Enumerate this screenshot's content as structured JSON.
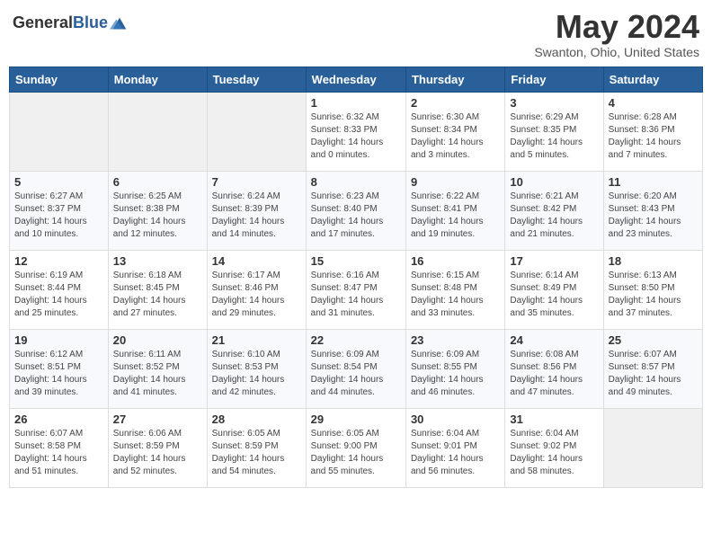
{
  "logo": {
    "general": "General",
    "blue": "Blue"
  },
  "title": "May 2024",
  "location": "Swanton, Ohio, United States",
  "days_of_week": [
    "Sunday",
    "Monday",
    "Tuesday",
    "Wednesday",
    "Thursday",
    "Friday",
    "Saturday"
  ],
  "weeks": [
    [
      {
        "day": "",
        "info": ""
      },
      {
        "day": "",
        "info": ""
      },
      {
        "day": "",
        "info": ""
      },
      {
        "day": "1",
        "info": "Sunrise: 6:32 AM\nSunset: 8:33 PM\nDaylight: 14 hours\nand 0 minutes."
      },
      {
        "day": "2",
        "info": "Sunrise: 6:30 AM\nSunset: 8:34 PM\nDaylight: 14 hours\nand 3 minutes."
      },
      {
        "day": "3",
        "info": "Sunrise: 6:29 AM\nSunset: 8:35 PM\nDaylight: 14 hours\nand 5 minutes."
      },
      {
        "day": "4",
        "info": "Sunrise: 6:28 AM\nSunset: 8:36 PM\nDaylight: 14 hours\nand 7 minutes."
      }
    ],
    [
      {
        "day": "5",
        "info": "Sunrise: 6:27 AM\nSunset: 8:37 PM\nDaylight: 14 hours\nand 10 minutes."
      },
      {
        "day": "6",
        "info": "Sunrise: 6:25 AM\nSunset: 8:38 PM\nDaylight: 14 hours\nand 12 minutes."
      },
      {
        "day": "7",
        "info": "Sunrise: 6:24 AM\nSunset: 8:39 PM\nDaylight: 14 hours\nand 14 minutes."
      },
      {
        "day": "8",
        "info": "Sunrise: 6:23 AM\nSunset: 8:40 PM\nDaylight: 14 hours\nand 17 minutes."
      },
      {
        "day": "9",
        "info": "Sunrise: 6:22 AM\nSunset: 8:41 PM\nDaylight: 14 hours\nand 19 minutes."
      },
      {
        "day": "10",
        "info": "Sunrise: 6:21 AM\nSunset: 8:42 PM\nDaylight: 14 hours\nand 21 minutes."
      },
      {
        "day": "11",
        "info": "Sunrise: 6:20 AM\nSunset: 8:43 PM\nDaylight: 14 hours\nand 23 minutes."
      }
    ],
    [
      {
        "day": "12",
        "info": "Sunrise: 6:19 AM\nSunset: 8:44 PM\nDaylight: 14 hours\nand 25 minutes."
      },
      {
        "day": "13",
        "info": "Sunrise: 6:18 AM\nSunset: 8:45 PM\nDaylight: 14 hours\nand 27 minutes."
      },
      {
        "day": "14",
        "info": "Sunrise: 6:17 AM\nSunset: 8:46 PM\nDaylight: 14 hours\nand 29 minutes."
      },
      {
        "day": "15",
        "info": "Sunrise: 6:16 AM\nSunset: 8:47 PM\nDaylight: 14 hours\nand 31 minutes."
      },
      {
        "day": "16",
        "info": "Sunrise: 6:15 AM\nSunset: 8:48 PM\nDaylight: 14 hours\nand 33 minutes."
      },
      {
        "day": "17",
        "info": "Sunrise: 6:14 AM\nSunset: 8:49 PM\nDaylight: 14 hours\nand 35 minutes."
      },
      {
        "day": "18",
        "info": "Sunrise: 6:13 AM\nSunset: 8:50 PM\nDaylight: 14 hours\nand 37 minutes."
      }
    ],
    [
      {
        "day": "19",
        "info": "Sunrise: 6:12 AM\nSunset: 8:51 PM\nDaylight: 14 hours\nand 39 minutes."
      },
      {
        "day": "20",
        "info": "Sunrise: 6:11 AM\nSunset: 8:52 PM\nDaylight: 14 hours\nand 41 minutes."
      },
      {
        "day": "21",
        "info": "Sunrise: 6:10 AM\nSunset: 8:53 PM\nDaylight: 14 hours\nand 42 minutes."
      },
      {
        "day": "22",
        "info": "Sunrise: 6:09 AM\nSunset: 8:54 PM\nDaylight: 14 hours\nand 44 minutes."
      },
      {
        "day": "23",
        "info": "Sunrise: 6:09 AM\nSunset: 8:55 PM\nDaylight: 14 hours\nand 46 minutes."
      },
      {
        "day": "24",
        "info": "Sunrise: 6:08 AM\nSunset: 8:56 PM\nDaylight: 14 hours\nand 47 minutes."
      },
      {
        "day": "25",
        "info": "Sunrise: 6:07 AM\nSunset: 8:57 PM\nDaylight: 14 hours\nand 49 minutes."
      }
    ],
    [
      {
        "day": "26",
        "info": "Sunrise: 6:07 AM\nSunset: 8:58 PM\nDaylight: 14 hours\nand 51 minutes."
      },
      {
        "day": "27",
        "info": "Sunrise: 6:06 AM\nSunset: 8:59 PM\nDaylight: 14 hours\nand 52 minutes."
      },
      {
        "day": "28",
        "info": "Sunrise: 6:05 AM\nSunset: 8:59 PM\nDaylight: 14 hours\nand 54 minutes."
      },
      {
        "day": "29",
        "info": "Sunrise: 6:05 AM\nSunset: 9:00 PM\nDaylight: 14 hours\nand 55 minutes."
      },
      {
        "day": "30",
        "info": "Sunrise: 6:04 AM\nSunset: 9:01 PM\nDaylight: 14 hours\nand 56 minutes."
      },
      {
        "day": "31",
        "info": "Sunrise: 6:04 AM\nSunset: 9:02 PM\nDaylight: 14 hours\nand 58 minutes."
      },
      {
        "day": "",
        "info": ""
      }
    ]
  ]
}
